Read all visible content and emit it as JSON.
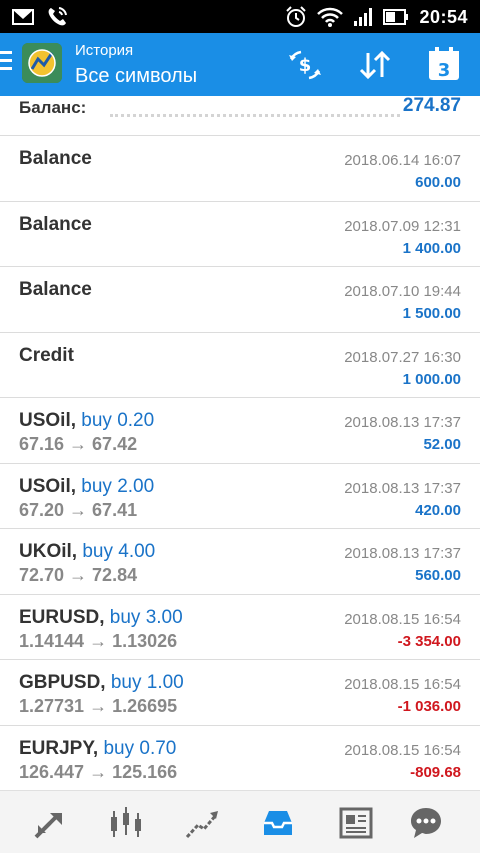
{
  "status_bar": {
    "time": "20:54",
    "icons": [
      "mail-icon",
      "phone-icon",
      "alarm-icon",
      "wifi-icon",
      "signal-icon",
      "battery-icon"
    ]
  },
  "app_bar": {
    "title": "История",
    "subtitle": "Все символы",
    "calendar_day": "3",
    "accent_color": "#1a8ee6"
  },
  "summary": {
    "label": "Баланс:",
    "value": "274.87"
  },
  "history": [
    {
      "symbol": "Balance",
      "action": "",
      "open": "",
      "close": "",
      "date": "2018.06.14 16:07",
      "amount": "600.00",
      "sign": "pos"
    },
    {
      "symbol": "Balance",
      "action": "",
      "open": "",
      "close": "",
      "date": "2018.07.09 12:31",
      "amount": "1 400.00",
      "sign": "pos"
    },
    {
      "symbol": "Balance",
      "action": "",
      "open": "",
      "close": "",
      "date": "2018.07.10 19:44",
      "amount": "1 500.00",
      "sign": "pos"
    },
    {
      "symbol": "Credit",
      "action": "",
      "open": "",
      "close": "",
      "date": "2018.07.27 16:30",
      "amount": "1 000.00",
      "sign": "pos"
    },
    {
      "symbol": "USOil,",
      "action": "buy 0.20",
      "open": "67.16",
      "close": "67.42",
      "date": "2018.08.13 17:37",
      "amount": "52.00",
      "sign": "pos"
    },
    {
      "symbol": "USOil,",
      "action": "buy 2.00",
      "open": "67.20",
      "close": "67.41",
      "date": "2018.08.13 17:37",
      "amount": "420.00",
      "sign": "pos"
    },
    {
      "symbol": "UKOil,",
      "action": "buy 4.00",
      "open": "72.70",
      "close": "72.84",
      "date": "2018.08.13 17:37",
      "amount": "560.00",
      "sign": "pos"
    },
    {
      "symbol": "EURUSD,",
      "action": "buy 3.00",
      "open": "1.14144",
      "close": "1.13026",
      "date": "2018.08.15 16:54",
      "amount": "-3 354.00",
      "sign": "neg"
    },
    {
      "symbol": "GBPUSD,",
      "action": "buy 1.00",
      "open": "1.27731",
      "close": "1.26695",
      "date": "2018.08.15 16:54",
      "amount": "-1 036.00",
      "sign": "neg"
    },
    {
      "symbol": "EURJPY,",
      "action": "buy 0.70",
      "open": "126.447",
      "close": "125.166",
      "date": "2018.08.15 16:54",
      "amount": "-809.68",
      "sign": "neg"
    }
  ],
  "price_arrow": "→",
  "bottom_nav": [
    {
      "icon": "quotes-icon",
      "active": false
    },
    {
      "icon": "chart-icon",
      "active": false
    },
    {
      "icon": "trade-icon",
      "active": false
    },
    {
      "icon": "history-icon",
      "active": true
    },
    {
      "icon": "news-icon",
      "active": false
    },
    {
      "icon": "chat-icon",
      "active": false
    }
  ],
  "colors": {
    "positive": "#1a73c8",
    "negative": "#d0171e",
    "active_nav": "#1a8ee6",
    "inactive_nav": "#666666"
  }
}
